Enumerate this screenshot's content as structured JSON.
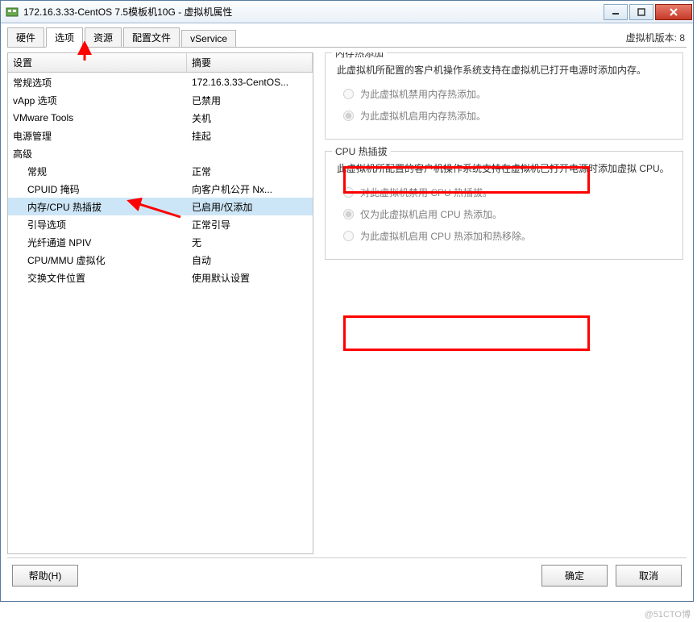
{
  "window": {
    "title": "172.16.3.33-CentOS 7.5模板机10G - 虚拟机属性",
    "buttons": {
      "min": "—",
      "max": "☐",
      "close": "✕"
    }
  },
  "tabs": [
    "硬件",
    "选项",
    "资源",
    "配置文件",
    "vService"
  ],
  "active_tab": 1,
  "version_label": "虚拟机版本: 8",
  "tree_headers": {
    "col1": "设置",
    "col2": "摘要"
  },
  "tree_rows": [
    {
      "label": "常规选项",
      "summary": "172.16.3.33-CentOS...",
      "indent": false
    },
    {
      "label": "vApp 选项",
      "summary": "已禁用",
      "indent": false
    },
    {
      "label": "VMware Tools",
      "summary": "关机",
      "indent": false
    },
    {
      "label": "电源管理",
      "summary": "挂起",
      "indent": false
    },
    {
      "label": "高级",
      "summary": "",
      "indent": false
    },
    {
      "label": "常规",
      "summary": "正常",
      "indent": true
    },
    {
      "label": "CPUID 掩码",
      "summary": "向客户机公开 Nx...",
      "indent": true
    },
    {
      "label": "内存/CPU 热插拔",
      "summary": "已启用/仅添加",
      "indent": true,
      "selected": true
    },
    {
      "label": "引导选项",
      "summary": "正常引导",
      "indent": true
    },
    {
      "label": "光纤通道 NPIV",
      "summary": "无",
      "indent": true
    },
    {
      "label": "CPU/MMU 虚拟化",
      "summary": "自动",
      "indent": true
    },
    {
      "label": "交换文件位置",
      "summary": "使用默认设置",
      "indent": true
    }
  ],
  "memory_group": {
    "title": "内存热添加",
    "desc": "此虚拟机所配置的客户机操作系统支持在虚拟机已打开电源时添加内存。",
    "opt1": "为此虚拟机禁用内存热添加。",
    "opt2": "为此虚拟机启用内存热添加。"
  },
  "cpu_group": {
    "title": "CPU 热插拔",
    "desc": "此虚拟机所配置的客户机操作系统支持在虚拟机已打开电源时添加虚拟 CPU。",
    "opt1": "对此虚拟机禁用 CPU 热插拔。",
    "opt2": "仅为此虚拟机启用 CPU 热添加。",
    "opt3": "为此虚拟机启用 CPU 热添加和热移除。"
  },
  "buttons": {
    "help": "帮助(H)",
    "ok": "确定",
    "cancel": "取消"
  },
  "watermark": "@51CTO博"
}
